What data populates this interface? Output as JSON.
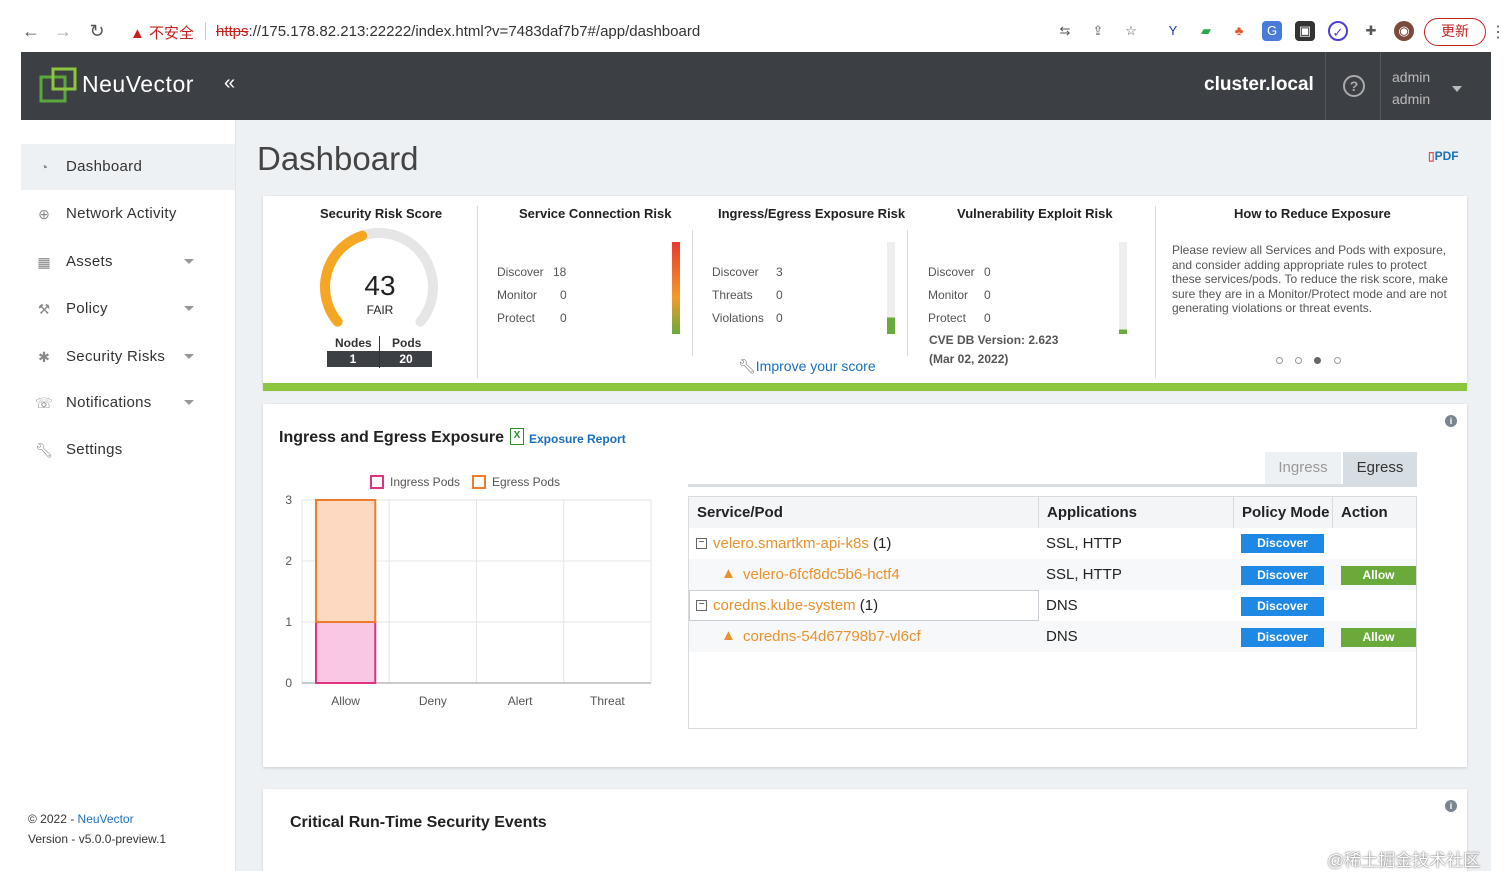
{
  "browser": {
    "security_warning": "不安全",
    "url_scheme": "https",
    "url_rest": "://175.178.82.213:22222/index.html?v=7483daf7b7#/app/dashboard",
    "update_label": "更新"
  },
  "header": {
    "brand": "NeuVector",
    "collapse": "«",
    "cluster": "cluster.local",
    "help": "?",
    "user_role": "admin",
    "user_name": "admin"
  },
  "sidebar": {
    "items": [
      {
        "label": "Dashboard",
        "icon": "dashboard-icon",
        "active": true
      },
      {
        "label": "Network Activity",
        "icon": "globe-icon"
      },
      {
        "label": "Assets",
        "icon": "cubes-icon",
        "expandable": true
      },
      {
        "label": "Policy",
        "icon": "gavel-icon",
        "expandable": true
      },
      {
        "label": "Security Risks",
        "icon": "bug-icon",
        "expandable": true
      },
      {
        "label": "Notifications",
        "icon": "bell-icon",
        "expandable": true
      },
      {
        "label": "Settings",
        "icon": "wrench-icon"
      }
    ],
    "copyright_prefix": "© 2022 - ",
    "copyright_link": "NeuVector",
    "version": "Version - v5.0.0-preview.1"
  },
  "page": {
    "title": "Dashboard",
    "pdf": "PDF"
  },
  "risk": {
    "score_title": "Security Risk Score",
    "score": "43",
    "score_label": "FAIR",
    "score_fraction": 0.43,
    "nodes_label": "Nodes",
    "nodes": "1",
    "pods_label": "Pods",
    "pods": "20",
    "service_title": "Service Connection Risk",
    "service_stats": [
      {
        "label": "Discover",
        "value": "18"
      },
      {
        "label": "Monitor",
        "value": "0"
      },
      {
        "label": "Protect",
        "value": "0"
      }
    ],
    "ingress_title": "Ingress/Egress Exposure Risk",
    "ingress_stats": [
      {
        "label": "Discover",
        "value": "3"
      },
      {
        "label": "Threats",
        "value": "0"
      },
      {
        "label": "Violations",
        "value": "0"
      }
    ],
    "improve": "Improve your score",
    "vuln_title": "Vulnerability Exploit Risk",
    "vuln_stats": [
      {
        "label": "Discover",
        "value": "0"
      },
      {
        "label": "Monitor",
        "value": "0"
      },
      {
        "label": "Protect",
        "value": "0"
      }
    ],
    "cve_version": "CVE DB Version: 2.623",
    "cve_date": "(Mar 02, 2022)",
    "reduce_title": "How to Reduce Exposure",
    "reduce_text": "Please review all Services and Pods with exposure, and consider adding appropriate rules to protect these services/pods. To reduce the risk score, make sure they are in a Monitor/Protect mode and are not generating violations or threat events."
  },
  "exposure": {
    "title": "Ingress and Egress Exposure",
    "report": "Exposure Report",
    "tabs": [
      "Ingress",
      "Egress"
    ],
    "active_tab": "Egress",
    "columns": [
      "Service/Pod",
      "Applications",
      "Policy Mode",
      "Action"
    ],
    "rows": [
      {
        "name": "velero.smartkm-api-k8s",
        "count": "(1)",
        "apps": "SSL, HTTP",
        "mode": "Discover",
        "action": "",
        "child": false
      },
      {
        "name": "velero-6fcf8dc5b6-hctf4",
        "count": "",
        "apps": "SSL, HTTP",
        "mode": "Discover",
        "action": "Allow",
        "child": true
      },
      {
        "name": "coredns.kube-system",
        "count": "(1)",
        "apps": "DNS",
        "mode": "Discover",
        "action": "",
        "child": false
      },
      {
        "name": "coredns-54d67798b7-vl6cf",
        "count": "",
        "apps": "DNS",
        "mode": "Discover",
        "action": "Allow",
        "child": true
      }
    ]
  },
  "chart_data": {
    "type": "bar",
    "stacked": true,
    "categories": [
      "Allow",
      "Deny",
      "Alert",
      "Threat"
    ],
    "series": [
      {
        "name": "Ingress Pods",
        "values": [
          1,
          0,
          0,
          0
        ],
        "color": "#f9c6e3",
        "border": "#e0337f"
      },
      {
        "name": "Egress Pods",
        "values": [
          2,
          0,
          0,
          0
        ],
        "color": "#fcd9c0",
        "border": "#f07b2a"
      }
    ],
    "ylim": [
      0,
      3
    ],
    "yticks": [
      "0",
      "1",
      "2",
      "3"
    ],
    "grid": true,
    "legend": "top"
  },
  "critical": {
    "title": "Critical Run-Time Security Events"
  },
  "watermark": "@稀土掘金技术社区",
  "colors": {
    "header_bg": "#3c3f44",
    "accent_blue": "#1a6fbd",
    "discover_blue": "#1e88e5",
    "allow_green": "#6aaa3a",
    "risk_bar_green": "#8cc63f",
    "gauge_orange": "#f5a623"
  }
}
